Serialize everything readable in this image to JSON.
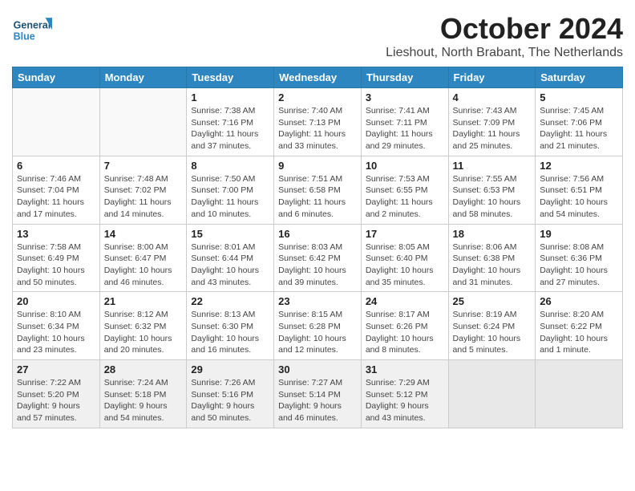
{
  "logo": {
    "line1": "General",
    "line2": "Blue"
  },
  "title": "October 2024",
  "location": "Lieshout, North Brabant, The Netherlands",
  "days_of_week": [
    "Sunday",
    "Monday",
    "Tuesday",
    "Wednesday",
    "Thursday",
    "Friday",
    "Saturday"
  ],
  "weeks": [
    [
      {
        "day": "",
        "info": ""
      },
      {
        "day": "",
        "info": ""
      },
      {
        "day": "1",
        "info": "Sunrise: 7:38 AM\nSunset: 7:16 PM\nDaylight: 11 hours\nand 37 minutes."
      },
      {
        "day": "2",
        "info": "Sunrise: 7:40 AM\nSunset: 7:13 PM\nDaylight: 11 hours\nand 33 minutes."
      },
      {
        "day": "3",
        "info": "Sunrise: 7:41 AM\nSunset: 7:11 PM\nDaylight: 11 hours\nand 29 minutes."
      },
      {
        "day": "4",
        "info": "Sunrise: 7:43 AM\nSunset: 7:09 PM\nDaylight: 11 hours\nand 25 minutes."
      },
      {
        "day": "5",
        "info": "Sunrise: 7:45 AM\nSunset: 7:06 PM\nDaylight: 11 hours\nand 21 minutes."
      }
    ],
    [
      {
        "day": "6",
        "info": "Sunrise: 7:46 AM\nSunset: 7:04 PM\nDaylight: 11 hours\nand 17 minutes."
      },
      {
        "day": "7",
        "info": "Sunrise: 7:48 AM\nSunset: 7:02 PM\nDaylight: 11 hours\nand 14 minutes."
      },
      {
        "day": "8",
        "info": "Sunrise: 7:50 AM\nSunset: 7:00 PM\nDaylight: 11 hours\nand 10 minutes."
      },
      {
        "day": "9",
        "info": "Sunrise: 7:51 AM\nSunset: 6:58 PM\nDaylight: 11 hours\nand 6 minutes."
      },
      {
        "day": "10",
        "info": "Sunrise: 7:53 AM\nSunset: 6:55 PM\nDaylight: 11 hours\nand 2 minutes."
      },
      {
        "day": "11",
        "info": "Sunrise: 7:55 AM\nSunset: 6:53 PM\nDaylight: 10 hours\nand 58 minutes."
      },
      {
        "day": "12",
        "info": "Sunrise: 7:56 AM\nSunset: 6:51 PM\nDaylight: 10 hours\nand 54 minutes."
      }
    ],
    [
      {
        "day": "13",
        "info": "Sunrise: 7:58 AM\nSunset: 6:49 PM\nDaylight: 10 hours\nand 50 minutes."
      },
      {
        "day": "14",
        "info": "Sunrise: 8:00 AM\nSunset: 6:47 PM\nDaylight: 10 hours\nand 46 minutes."
      },
      {
        "day": "15",
        "info": "Sunrise: 8:01 AM\nSunset: 6:44 PM\nDaylight: 10 hours\nand 43 minutes."
      },
      {
        "day": "16",
        "info": "Sunrise: 8:03 AM\nSunset: 6:42 PM\nDaylight: 10 hours\nand 39 minutes."
      },
      {
        "day": "17",
        "info": "Sunrise: 8:05 AM\nSunset: 6:40 PM\nDaylight: 10 hours\nand 35 minutes."
      },
      {
        "day": "18",
        "info": "Sunrise: 8:06 AM\nSunset: 6:38 PM\nDaylight: 10 hours\nand 31 minutes."
      },
      {
        "day": "19",
        "info": "Sunrise: 8:08 AM\nSunset: 6:36 PM\nDaylight: 10 hours\nand 27 minutes."
      }
    ],
    [
      {
        "day": "20",
        "info": "Sunrise: 8:10 AM\nSunset: 6:34 PM\nDaylight: 10 hours\nand 23 minutes."
      },
      {
        "day": "21",
        "info": "Sunrise: 8:12 AM\nSunset: 6:32 PM\nDaylight: 10 hours\nand 20 minutes."
      },
      {
        "day": "22",
        "info": "Sunrise: 8:13 AM\nSunset: 6:30 PM\nDaylight: 10 hours\nand 16 minutes."
      },
      {
        "day": "23",
        "info": "Sunrise: 8:15 AM\nSunset: 6:28 PM\nDaylight: 10 hours\nand 12 minutes."
      },
      {
        "day": "24",
        "info": "Sunrise: 8:17 AM\nSunset: 6:26 PM\nDaylight: 10 hours\nand 8 minutes."
      },
      {
        "day": "25",
        "info": "Sunrise: 8:19 AM\nSunset: 6:24 PM\nDaylight: 10 hours\nand 5 minutes."
      },
      {
        "day": "26",
        "info": "Sunrise: 8:20 AM\nSunset: 6:22 PM\nDaylight: 10 hours\nand 1 minute."
      }
    ],
    [
      {
        "day": "27",
        "info": "Sunrise: 7:22 AM\nSunset: 5:20 PM\nDaylight: 9 hours\nand 57 minutes."
      },
      {
        "day": "28",
        "info": "Sunrise: 7:24 AM\nSunset: 5:18 PM\nDaylight: 9 hours\nand 54 minutes."
      },
      {
        "day": "29",
        "info": "Sunrise: 7:26 AM\nSunset: 5:16 PM\nDaylight: 9 hours\nand 50 minutes."
      },
      {
        "day": "30",
        "info": "Sunrise: 7:27 AM\nSunset: 5:14 PM\nDaylight: 9 hours\nand 46 minutes."
      },
      {
        "day": "31",
        "info": "Sunrise: 7:29 AM\nSunset: 5:12 PM\nDaylight: 9 hours\nand 43 minutes."
      },
      {
        "day": "",
        "info": ""
      },
      {
        "day": "",
        "info": ""
      }
    ]
  ]
}
